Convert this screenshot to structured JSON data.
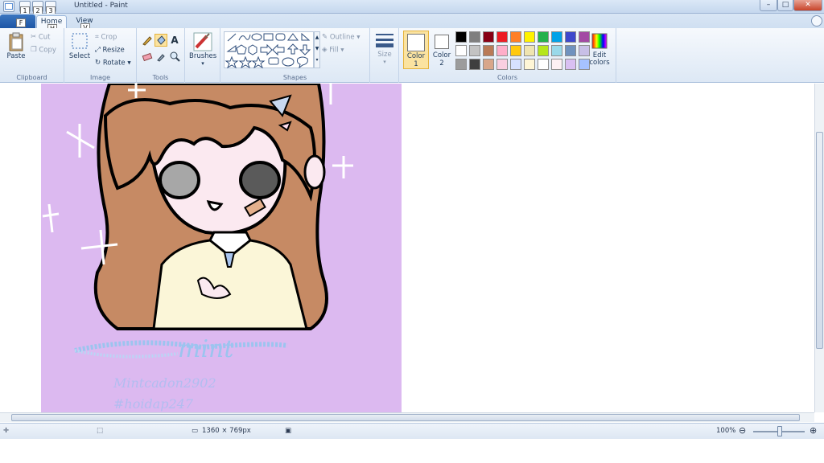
{
  "window": {
    "title": "Untitled - Paint",
    "qat_badges": [
      "1",
      "2",
      "3"
    ],
    "file_badge": "F",
    "minimize": "–",
    "restore": "□",
    "close": "✕"
  },
  "tabs": {
    "home": "Home",
    "home_key": "H",
    "view": "View",
    "view_key": "V"
  },
  "ribbon": {
    "clipboard": {
      "label": "Clipboard",
      "paste": "Paste",
      "cut": "Cut",
      "copy": "Copy"
    },
    "image": {
      "label": "Image",
      "select": "Select",
      "crop": "Crop",
      "resize": "Resize",
      "rotate": "Rotate"
    },
    "tools": {
      "label": "Tools"
    },
    "brushes": {
      "label": "Brushes"
    },
    "shapes": {
      "label": "Shapes",
      "outline": "Outline",
      "fill": "Fill"
    },
    "size": {
      "label": "Size"
    },
    "colors": {
      "label": "Colors",
      "color1": "Color",
      "color1_num": "1",
      "color2": "Color",
      "color2_num": "2",
      "edit": "Edit colors",
      "row1": [
        "#000000",
        "#7f7f7f",
        "#880015",
        "#ed1c24",
        "#ff7f27",
        "#fff200",
        "#22b14c",
        "#00a2e8",
        "#3f48cc",
        "#a349a4"
      ],
      "row2": [
        "#ffffff",
        "#c3c3c3",
        "#b97a57",
        "#ffaec9",
        "#ffc90e",
        "#efe4b0",
        "#b5e61d",
        "#99d9ea",
        "#7092be",
        "#c8bfe7"
      ],
      "row3": [
        "#9c9c9c",
        "#3f3f3f",
        "#d8a68a",
        "#f9cfe0",
        "#d6e1ff",
        "#fff6d6",
        "#ffffff",
        "#fdf0f4",
        "#d9c0f2",
        "#a6c2ff"
      ]
    }
  },
  "canvas": {
    "background": "#dcb9f0",
    "signature": "mint",
    "watermark_name": "Mintcadon2902",
    "watermark_tag": "#hoidap247"
  },
  "status": {
    "size": "1360 × 769px",
    "zoom": "100%"
  }
}
